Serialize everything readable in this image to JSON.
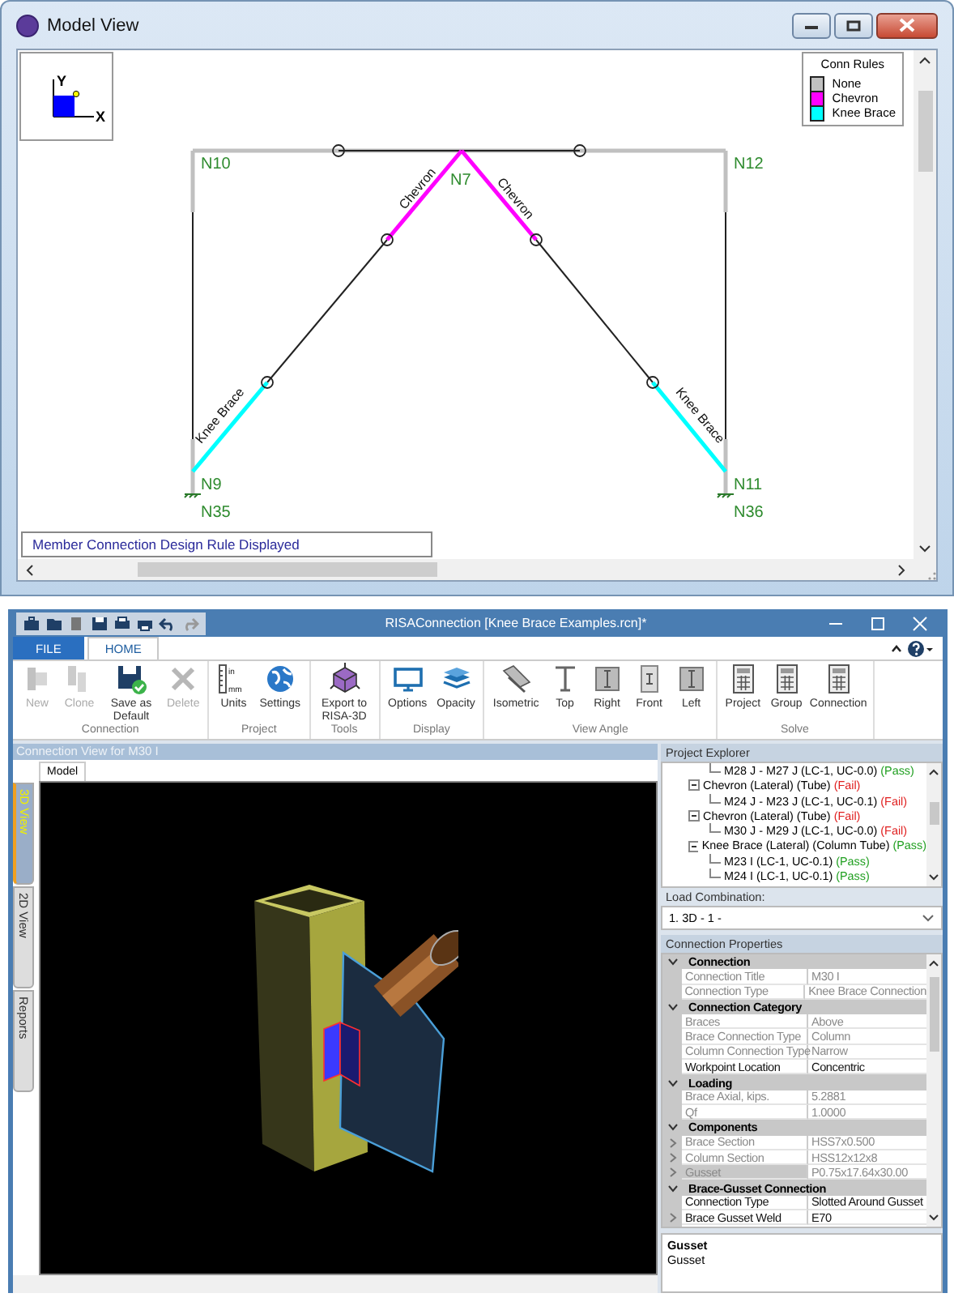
{
  "model_view": {
    "title": "Model View",
    "axis": {
      "y_label": "Y",
      "x_label": "X"
    },
    "legend": {
      "title": "Conn Rules",
      "items": [
        {
          "label": "None",
          "color": "#c0c0c0"
        },
        {
          "label": "Chevron",
          "color": "#ff00ff"
        },
        {
          "label": "Knee Brace",
          "color": "#00ffff"
        }
      ]
    },
    "nodes": [
      {
        "label": "N10"
      },
      {
        "label": "N7"
      },
      {
        "label": "N12"
      },
      {
        "label": "N9"
      },
      {
        "label": "N11"
      },
      {
        "label": "N35"
      },
      {
        "label": "N36"
      }
    ],
    "member_labels": [
      {
        "label": "Chevron"
      },
      {
        "label": "Chevron"
      },
      {
        "label": "Knee Brace"
      },
      {
        "label": "Knee Brace"
      }
    ],
    "status": "Member Connection Design Rule Displayed"
  },
  "app": {
    "title": "RISAConnection [Knee Brace Examples.rcn]*",
    "tabs": [
      {
        "label": "FILE",
        "kind": "file",
        "selected": false
      },
      {
        "label": "HOME",
        "kind": "tab",
        "selected": true
      }
    ],
    "ribbon": [
      {
        "label": "Connection",
        "buttons": [
          {
            "label": "New",
            "kind": "new",
            "disabled": true
          },
          {
            "label": "Clone",
            "kind": "clone",
            "disabled": true
          },
          {
            "label": "Save as Default",
            "kind": "save",
            "disabled": false
          },
          {
            "label": "Delete",
            "kind": "delete",
            "disabled": true
          }
        ]
      },
      {
        "label": "Project",
        "buttons": [
          {
            "label": "Units",
            "kind": "units",
            "icon_text": [
              "in",
              "mm"
            ],
            "disabled": false
          },
          {
            "label": "Settings",
            "kind": "globe",
            "disabled": false
          }
        ]
      },
      {
        "label": "Tools",
        "buttons": [
          {
            "label": "Export to RISA-3D",
            "kind": "cube",
            "disabled": false
          }
        ]
      },
      {
        "label": "Display",
        "buttons": [
          {
            "label": "Options",
            "kind": "monitor",
            "disabled": false
          },
          {
            "label": "Opacity",
            "kind": "layers",
            "disabled": false
          }
        ]
      },
      {
        "label": "View Angle",
        "buttons": [
          {
            "label": "Isometric",
            "kind": "iso",
            "disabled": false
          },
          {
            "label": "Top",
            "kind": "top",
            "disabled": false
          },
          {
            "label": "Right",
            "kind": "side",
            "disabled": false
          },
          {
            "label": "Front",
            "kind": "front",
            "disabled": false
          },
          {
            "label": "Left",
            "kind": "side",
            "disabled": false
          }
        ]
      },
      {
        "label": "Solve",
        "buttons": [
          {
            "label": "Project",
            "kind": "calc",
            "disabled": false
          },
          {
            "label": "Group",
            "kind": "calc",
            "disabled": false
          },
          {
            "label": "Connection",
            "kind": "calc",
            "disabled": false
          }
        ]
      }
    ],
    "view": {
      "header": "Connection View for M30 I",
      "model_tab": "Model",
      "side_tabs": [
        {
          "label": "3D View",
          "selected": true
        },
        {
          "label": "2D View",
          "selected": false
        },
        {
          "label": "Reports",
          "selected": false
        }
      ]
    },
    "explorer": {
      "title": "Project Explorer",
      "tree": [
        {
          "children": [
            {
              "text": "M28 J - M27 J (LC-1, UC-0.0)",
              "result": "(Pass)",
              "passed": true
            }
          ]
        },
        {
          "text": "Chevron (Lateral) (Tube)",
          "result": "(Fail)",
          "passed": false,
          "expanded": true,
          "children": [
            {
              "text": "M24 J - M23 J (LC-1, UC-0.1)",
              "result": "(Fail)",
              "passed": false
            }
          ]
        },
        {
          "text": "Chevron (Lateral) (Tube)",
          "result": "(Fail)",
          "passed": false,
          "expanded": true,
          "children": [
            {
              "text": "M30 J - M29 J (LC-1, UC-0.0)",
              "result": "(Fail)",
              "passed": false
            }
          ]
        },
        {
          "text": "Knee Brace (Lateral) (Column Tube)",
          "result": "(Pass)",
          "passed": true,
          "expanded": true,
          "children": [
            {
              "text": "M23 I (LC-1, UC-0.1)",
              "result": "(Pass)",
              "passed": true
            },
            {
              "text": "M24 I (LC-1, UC-0.1)",
              "result": "(Pass)",
              "passed": true
            }
          ]
        }
      ]
    },
    "load_combination": {
      "label": "Load Combination:",
      "value": "1. 3D - 1 -"
    },
    "properties": {
      "title": "Connection Properties",
      "sections": [
        {
          "title": "Connection",
          "expanded": true,
          "rows": [
            {
              "name": "Connection Title",
              "value": "M30 I",
              "readonly": true
            },
            {
              "name": "Connection Type",
              "value": "Knee Brace Connection",
              "readonly": true
            }
          ]
        },
        {
          "title": "Connection Category",
          "expanded": true,
          "rows": [
            {
              "name": "Braces",
              "value": "Above",
              "readonly": true
            },
            {
              "name": "Brace Connection Type",
              "value": "Column",
              "readonly": true
            },
            {
              "name": "Column Connection Type",
              "value": "Narrow",
              "readonly": true
            },
            {
              "name": "Workpoint Location",
              "value": "Concentric",
              "readonly": false
            }
          ]
        },
        {
          "title": "Loading",
          "expanded": true,
          "rows": [
            {
              "name": "Brace Axial, kips.",
              "value": "5.2881",
              "readonly": true
            },
            {
              "name": "Qf",
              "value": "1.0000",
              "readonly": true
            }
          ]
        },
        {
          "title": "Components",
          "expanded": true,
          "rows": [
            {
              "name": "Brace Section",
              "value": "HSS7x0.500",
              "readonly": true,
              "expandable": true,
              "selected": false
            },
            {
              "name": "Column Section",
              "value": "HSS12x12x8",
              "readonly": true,
              "expandable": true,
              "selected": false
            },
            {
              "name": "Gusset",
              "value": "P0.75x17.64x30.00",
              "readonly": true,
              "expandable": true,
              "selected": true
            }
          ]
        },
        {
          "title": "Brace-Gusset Connection",
          "expanded": true,
          "rows": [
            {
              "name": "Connection Type",
              "value": "Slotted Around Gusset",
              "readonly": false
            },
            {
              "name": "Brace Gusset Weld",
              "value": "E70",
              "readonly": false,
              "expandable": true
            }
          ]
        }
      ]
    },
    "description": {
      "title": "Gusset",
      "text": "Gusset"
    }
  }
}
